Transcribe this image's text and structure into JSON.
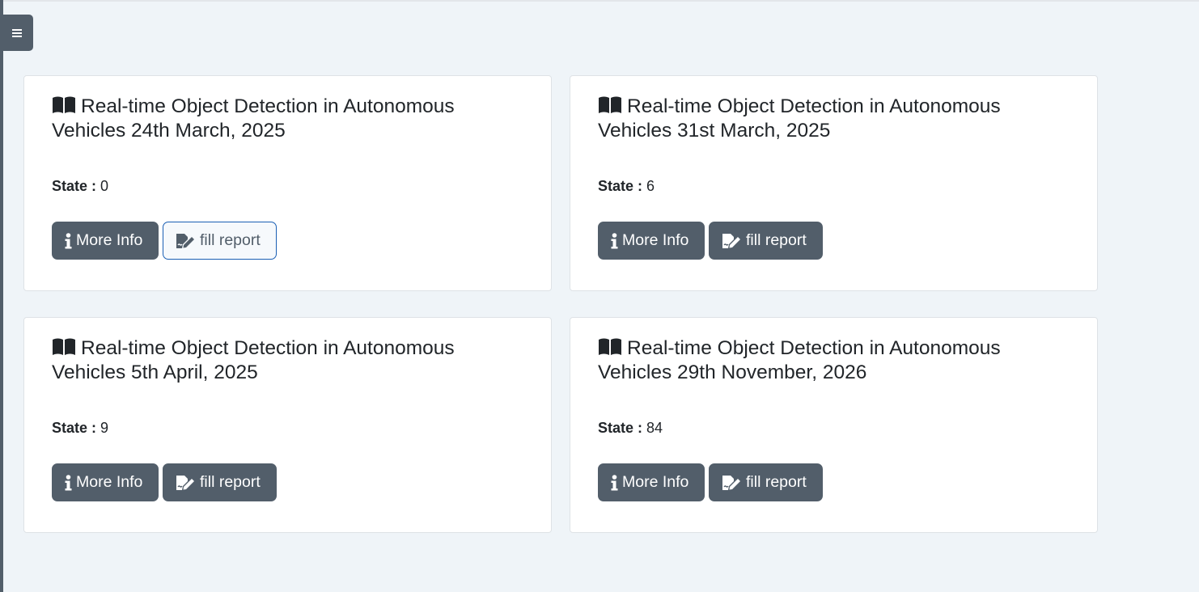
{
  "sidebar_toggle": {
    "icon": "hamburger-menu-icon"
  },
  "cards": [
    {
      "title": "Real-time Object Detection in Autonomous Vehicles 24th March, 2025",
      "state_label": "State :",
      "state_value": "0",
      "more_info_label": "More Info",
      "fill_report_label": "fill report",
      "fill_report_style": "outline"
    },
    {
      "title": "Real-time Object Detection in Autonomous Vehicles 31st March, 2025",
      "state_label": "State :",
      "state_value": "6",
      "more_info_label": "More Info",
      "fill_report_label": "fill report",
      "fill_report_style": "solid"
    },
    {
      "title": "Real-time Object Detection in Autonomous Vehicles 5th April, 2025",
      "state_label": "State :",
      "state_value": "9",
      "more_info_label": "More Info",
      "fill_report_label": "fill report",
      "fill_report_style": "solid"
    },
    {
      "title": "Real-time Object Detection in Autonomous Vehicles 29th November, 2026",
      "state_label": "State :",
      "state_value": "84",
      "more_info_label": "More Info",
      "fill_report_label": "fill report",
      "fill_report_style": "solid"
    }
  ],
  "icons": {
    "title": "book-open-icon",
    "more_info": "info-icon",
    "fill_report": "file-signature-icon"
  },
  "colors": {
    "background": "#eff4f8",
    "button": "#525e6a",
    "outline_border": "#1a5fb4",
    "card": "#ffffff"
  }
}
